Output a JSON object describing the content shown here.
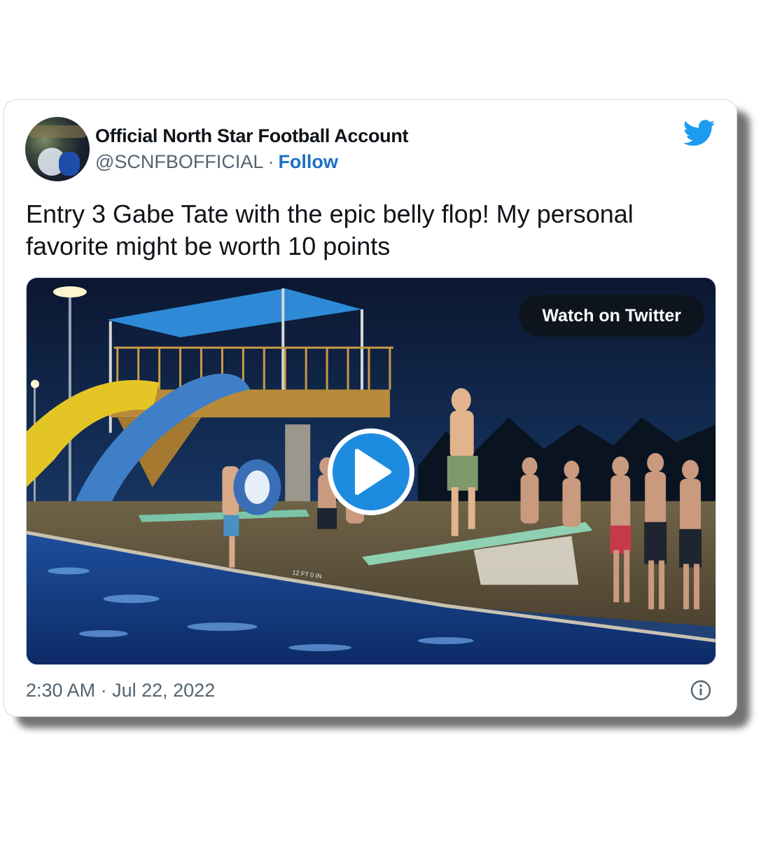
{
  "tweet": {
    "author_name": "Official North Star Football Account",
    "handle": "@SCNFBOFFICIAL",
    "separator": "·",
    "follow_label": "Follow",
    "text": "Entry 3 Gabe Tate with the epic belly flop! My personal favorite might be worth 10 points",
    "watch_label": "Watch on Twitter",
    "time": "2:30 AM",
    "date": "Jul 22, 2022",
    "board_marking": "12 FT 0 IN"
  },
  "icons": {
    "brand": "twitter-bird-icon",
    "play": "play-icon",
    "info": "info-icon"
  },
  "colors": {
    "brand_blue": "#1d9bf0",
    "follow_blue": "#1d70c4",
    "text_dark": "#0f1419",
    "text_muted": "#536471",
    "play_blue": "#1d8ce0"
  }
}
